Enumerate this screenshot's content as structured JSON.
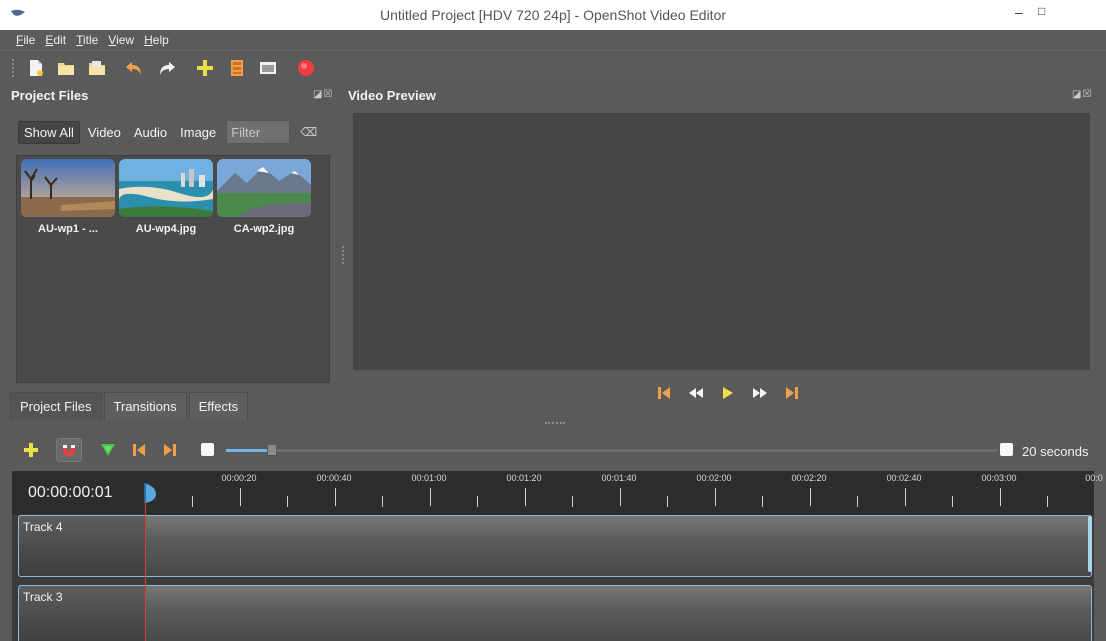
{
  "window": {
    "title": "Untitled Project [HDV 720 24p] - OpenShot Video Editor",
    "minimize": "–",
    "maximize": "□"
  },
  "menu": [
    "File",
    "Edit",
    "Title",
    "View",
    "Help"
  ],
  "toolbar": {
    "icons": [
      "new-project-icon",
      "open-project-icon",
      "save-project-icon",
      "undo-icon",
      "redo-icon",
      "import-files-icon",
      "profile-icon",
      "export-icon",
      "fullscreen-icon"
    ]
  },
  "project_files": {
    "title": "Project Files",
    "filters": [
      "Show All",
      "Video",
      "Audio",
      "Image"
    ],
    "filter_placeholder": "Filter",
    "files": [
      {
        "label": "AU-wp1 - ..."
      },
      {
        "label": "AU-wp4.jpg"
      },
      {
        "label": "CA-wp2.jpg"
      }
    ]
  },
  "tabs": [
    "Project Files",
    "Transitions",
    "Effects"
  ],
  "video_preview": {
    "title": "Video Preview"
  },
  "timeline": {
    "timecode": "00:00:00:01",
    "zoom_label": "20 seconds",
    "zoom_level": 0.06,
    "ticks": [
      "00:00:20",
      "00:00:40",
      "00:01:00",
      "00:01:20",
      "00:01:40",
      "00:02:00",
      "00:02:20",
      "00:02:40",
      "00:03:00",
      "00:0"
    ],
    "tracks": [
      {
        "label": "Track 4"
      },
      {
        "label": "Track 3"
      }
    ]
  },
  "colors": {
    "accent_orange": "#f0a04a",
    "playhead": "#e43a3a",
    "selection_blue": "#6fb7ee"
  }
}
